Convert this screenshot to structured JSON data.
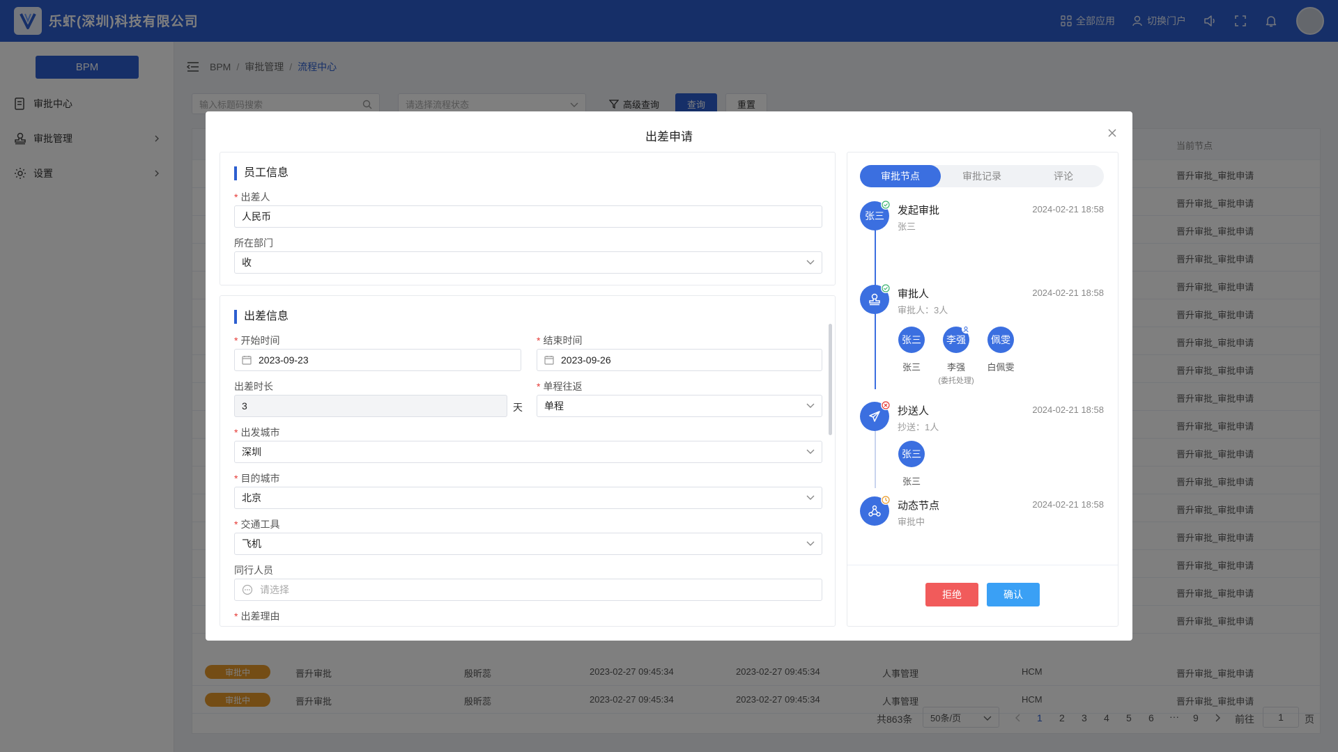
{
  "header": {
    "company": "乐虾(深圳)科技有限公司",
    "all_apps": "全部应用",
    "switch_portal": "切换门户"
  },
  "sidebar": {
    "bpm": "BPM",
    "items": [
      {
        "label": "审批中心"
      },
      {
        "label": "审批管理"
      },
      {
        "label": "设置"
      }
    ]
  },
  "breadcrumb": [
    "BPM",
    "审批管理",
    "流程中心"
  ],
  "filters": {
    "search_placeholder": "输入标题码搜索",
    "status_placeholder": "请选择流程状态",
    "advanced": "高级查询",
    "query": "查询",
    "reset": "重置"
  },
  "table": {
    "current_node_header": "当前节点",
    "row_node_value": "晋升审批_审批申请",
    "bottom_rows": [
      {
        "status": "审批中",
        "name": "晋升审批",
        "person": "殷昕蕊",
        "created": "2023-02-27 09:45:34",
        "updated": "2023-02-27 09:45:34",
        "category": "人事管理",
        "system": "HCM",
        "node": "晋升审批_审批申请"
      },
      {
        "status": "审批中",
        "name": "晋升审批",
        "person": "殷昕蕊",
        "created": "2023-02-27 09:45:34",
        "updated": "2023-02-27 09:45:34",
        "category": "人事管理",
        "system": "HCM",
        "node": "晋升审批_审批申请"
      }
    ]
  },
  "pagination": {
    "total": "共863条",
    "page_size": "50条/页",
    "pages": [
      "1",
      "2",
      "3",
      "4",
      "5",
      "6",
      "···",
      "9"
    ],
    "current_page": "1",
    "goto_prefix": "前往",
    "goto_value": "1",
    "goto_suffix": "页"
  },
  "modal": {
    "title": "出差申请",
    "employee_section": "员工信息",
    "fields": {
      "traveler_label": "出差人",
      "traveler_value": "人民币",
      "department_label": "所在部门",
      "department_value": "收"
    },
    "trip_section": "出差信息",
    "trip": {
      "start_label": "开始时间",
      "start_value": "2023-09-23",
      "end_label": "结束时间",
      "end_value": "2023-09-26",
      "duration_label": "出差时长",
      "duration_value": "3",
      "duration_unit": "天",
      "trip_type_label": "单程往返",
      "trip_type_value": "单程",
      "from_label": "出发城市",
      "from_value": "深圳",
      "to_label": "目的城市",
      "to_value": "北京",
      "transport_label": "交通工具",
      "transport_value": "飞机",
      "companions_label": "同行人员",
      "companions_placeholder": "请选择",
      "reason_label": "出差理由"
    },
    "tabs": [
      "审批节点",
      "审批记录",
      "评论"
    ],
    "timeline": [
      {
        "title": "发起审批",
        "sub": "张三",
        "time": "2024-02-21 18:58",
        "icon_text": "张三"
      },
      {
        "title": "审批人",
        "sub": "审批人：3人",
        "time": "2024-02-21 18:58"
      },
      {
        "title": "抄送人",
        "sub": "抄送：1人",
        "time": "2024-02-21 18:58"
      },
      {
        "title": "动态节点",
        "sub": "审批中",
        "time": "2024-02-21 18:58"
      }
    ],
    "approvers": [
      {
        "avatar": "张三",
        "name": "张三",
        "note": ""
      },
      {
        "avatar": "李强",
        "name": "李强",
        "note": "(委托处理)"
      },
      {
        "avatar": "佩雯",
        "name": "白佩雯",
        "note": ""
      }
    ],
    "cc": [
      {
        "avatar": "张三",
        "name": "张三"
      }
    ],
    "reject": "拒绝",
    "confirm": "确认"
  },
  "colors": {
    "primary": "#2d5fd0",
    "accent": "#3b6fe0",
    "danger": "#f15b5b",
    "confirm": "#3aa0f5",
    "warning": "#e99b2b"
  }
}
